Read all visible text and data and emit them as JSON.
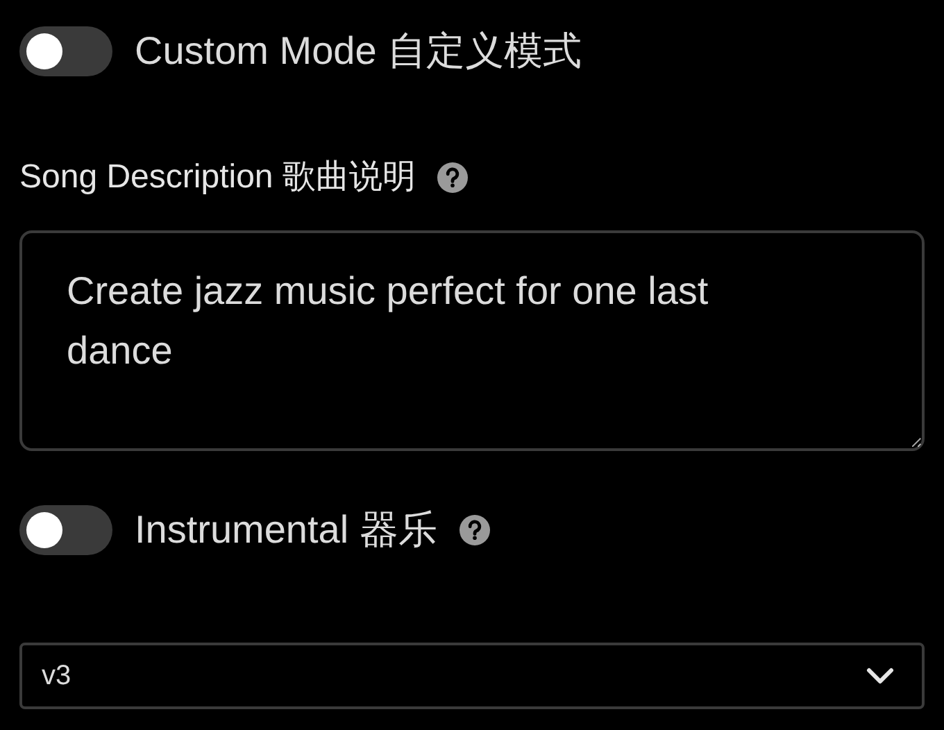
{
  "custom_mode": {
    "label": "Custom Mode 自定义模式",
    "on": false
  },
  "song_description": {
    "label": "Song Description 歌曲说明",
    "value": "Create jazz music perfect for one last dance"
  },
  "instrumental": {
    "label": "Instrumental 器乐",
    "on": false
  },
  "version_select": {
    "value": "v3"
  }
}
